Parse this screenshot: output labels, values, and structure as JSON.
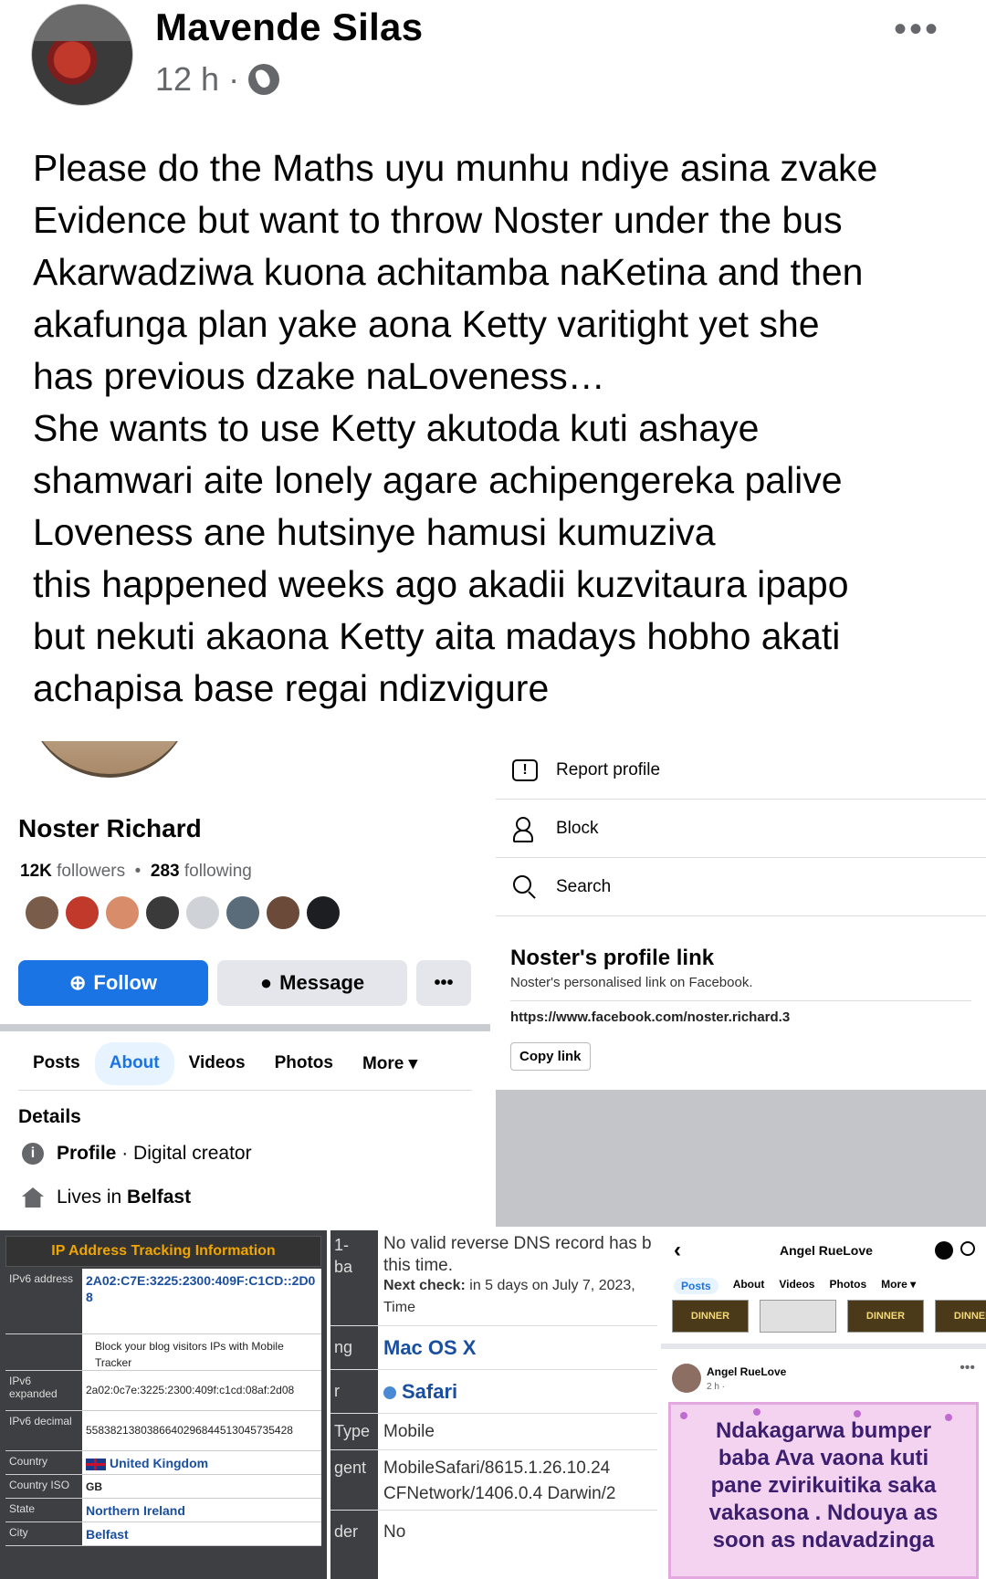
{
  "post": {
    "author": "Mavende Silas",
    "time": "12 h",
    "separator": "·",
    "more_label": "•••",
    "lines": [
      "Please do the Maths uyu munhu ndiye asina zvake",
      "Evidence but want to throw Noster under the bus",
      "Akarwadziwa kuona achitamba naKetina and then",
      "akafunga plan yake aona Ketty varitight yet she",
      "has previous dzake naLoveness…",
      "She wants to use Ketty akutoda kuti ashaye",
      "shamwari aite lonely agare achipengereka palive",
      "Loveness ane hutsinye hamusi kumuziva",
      "this happened weeks ago akadii kuzvitaura ipapo",
      "but nekuti akaona Ketty aita madays hobho akati",
      "achapisa base regai ndizvigure"
    ]
  },
  "profile": {
    "name": "Noster Richard",
    "followers": "12K",
    "followers_label": "followers",
    "following": "283",
    "following_label": "following",
    "follow_btn": "Follow",
    "message_btn": "Message",
    "more_btn": "•••",
    "tabs": [
      "Posts",
      "About",
      "Videos",
      "Photos",
      "More ▾"
    ],
    "details_heading": "Details",
    "profile_label": "Profile",
    "profile_value": "· Digital creator",
    "lives_prefix": "Lives in ",
    "lives_city": "Belfast"
  },
  "menu": {
    "report": "Report profile",
    "block": "Block",
    "search": "Search",
    "link_heading": "Noster's profile link",
    "link_sub": "Noster's personalised link on Facebook.",
    "link_url": "https://www.facebook.com/noster.richard.3",
    "copy_btn": "Copy link"
  },
  "ip": {
    "title": "IP Address Tracking Information",
    "rows": [
      {
        "key": "IPv6 address",
        "value": "2A02:C7E:3225:2300:409F:C1CD::2D08"
      },
      {
        "key": "",
        "value": "Block your blog visitors IPs with Mobile Tracker"
      },
      {
        "key": "IPv6 expanded",
        "value": "2a02:0c7e:3225:2300:409f:c1cd:08af:2d08"
      },
      {
        "key": "IPv6 decimal",
        "value": "55838213803866402968445130457354​28"
      },
      {
        "key": "Country",
        "value": "United Kingdom"
      },
      {
        "key": "Country ISO",
        "value": "GB"
      },
      {
        "key": "State",
        "value": "Northern Ireland"
      },
      {
        "key": "City",
        "value": "Belfast"
      }
    ]
  },
  "browser": {
    "dns_line1": "No valid reverse DNS record has b",
    "dns_line2": "this time.",
    "next_check_label": "Next check:",
    "next_check_value": " in 5 days on July 7, 2023,",
    "time_label": "Time",
    "os": "Mac OS X",
    "browser": "Safari",
    "type_key": "Type",
    "type_value": "Mobile",
    "agent_key": "gent",
    "agent_line1": "MobileSafari/8615.1.26.10.24",
    "agent_line2": "CFNetwork/1406.0.4 Darwin/2",
    "header_key": "der",
    "header_value": "No",
    "left_frag1": "1-",
    "left_frag2": "ba",
    "left_frag3": "ng",
    "left_frag4": "r"
  },
  "angel": {
    "back": "‹",
    "title": "Angel RueLove",
    "tabs": [
      "Posts",
      "About",
      "Videos",
      "Photos",
      "More ▾"
    ],
    "thumb_label": "DINNER",
    "author": "Angel RueLove",
    "time": "2 h ·",
    "card_text": [
      "Ndakagarwa bumper",
      "baba Ava vaona kuti",
      "pane zvirikuitika saka",
      "vakasona . Ndouya as",
      "soon as ndavadzinga"
    ]
  }
}
